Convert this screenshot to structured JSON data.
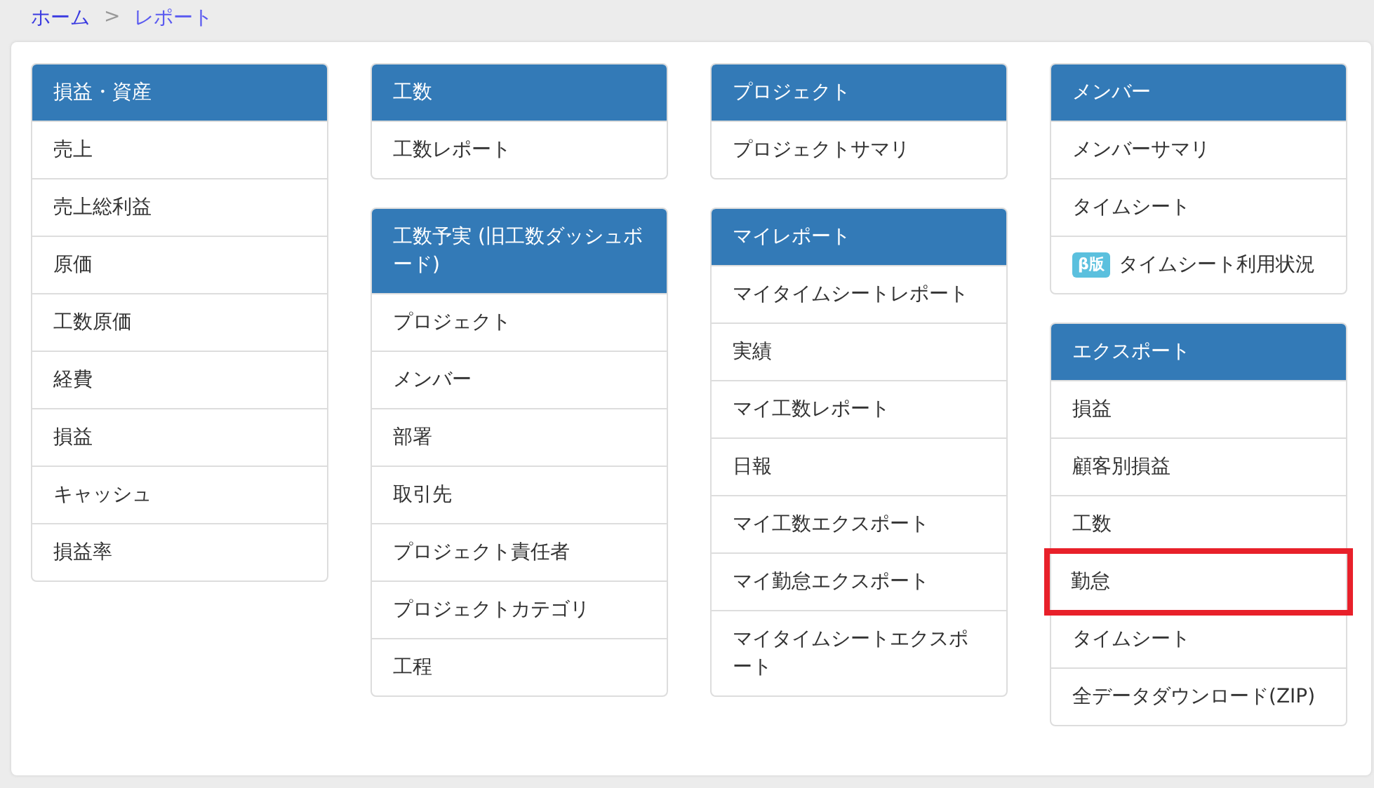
{
  "breadcrumb": [
    {
      "label": "ホーム",
      "selected": false
    },
    {
      "label": "レポート",
      "selected": true
    }
  ],
  "breadcrumb_separator": ">",
  "columns": [
    {
      "panels": [
        {
          "title": "損益・資産",
          "items": [
            {
              "label": "売上",
              "highlighted": false
            },
            {
              "label": "売上総利益",
              "highlighted": false
            },
            {
              "label": "原価",
              "highlighted": false
            },
            {
              "label": "工数原価",
              "highlighted": false
            },
            {
              "label": "経費",
              "highlighted": false
            },
            {
              "label": "損益",
              "highlighted": false
            },
            {
              "label": "キャッシュ",
              "highlighted": false
            },
            {
              "label": "損益率",
              "highlighted": false
            }
          ]
        }
      ]
    },
    {
      "panels": [
        {
          "title": "工数",
          "items": [
            {
              "label": "工数レポート",
              "highlighted": false
            }
          ]
        },
        {
          "title": "工数予実 (旧工数ダッシュボード)",
          "items": [
            {
              "label": "プロジェクト",
              "highlighted": false
            },
            {
              "label": "メンバー",
              "highlighted": false
            },
            {
              "label": "部署",
              "highlighted": false
            },
            {
              "label": "取引先",
              "highlighted": false
            },
            {
              "label": "プロジェクト責任者",
              "highlighted": false
            },
            {
              "label": "プロジェクトカテゴリ",
              "highlighted": false
            },
            {
              "label": "工程",
              "highlighted": false
            }
          ]
        }
      ]
    },
    {
      "panels": [
        {
          "title": "プロジェクト",
          "items": [
            {
              "label": "プロジェクトサマリ",
              "highlighted": false
            }
          ]
        },
        {
          "title": "マイレポート",
          "items": [
            {
              "label": "マイタイムシートレポート",
              "highlighted": false
            },
            {
              "label": "実績",
              "highlighted": false
            },
            {
              "label": "マイ工数レポート",
              "highlighted": false
            },
            {
              "label": "日報",
              "highlighted": false
            },
            {
              "label": "マイ工数エクスポート",
              "highlighted": false
            },
            {
              "label": "マイ勤怠エクスポート",
              "highlighted": false
            },
            {
              "label": "マイタイムシートエクスポート",
              "highlighted": false
            }
          ]
        }
      ]
    },
    {
      "panels": [
        {
          "title": "メンバー",
          "items": [
            {
              "label": "メンバーサマリ",
              "highlighted": false
            },
            {
              "label": "タイムシート",
              "highlighted": false
            },
            {
              "label": "タイムシート利用状況",
              "badge": "β版",
              "highlighted": false
            }
          ]
        },
        {
          "title": "エクスポート",
          "items": [
            {
              "label": "損益",
              "highlighted": false
            },
            {
              "label": "顧客別損益",
              "highlighted": false
            },
            {
              "label": "工数",
              "highlighted": false
            },
            {
              "label": "勤怠",
              "highlighted": true
            },
            {
              "label": "タイムシート",
              "highlighted": false
            },
            {
              "label": "全データダウンロード(ZIP)",
              "highlighted": false
            }
          ]
        }
      ]
    }
  ]
}
